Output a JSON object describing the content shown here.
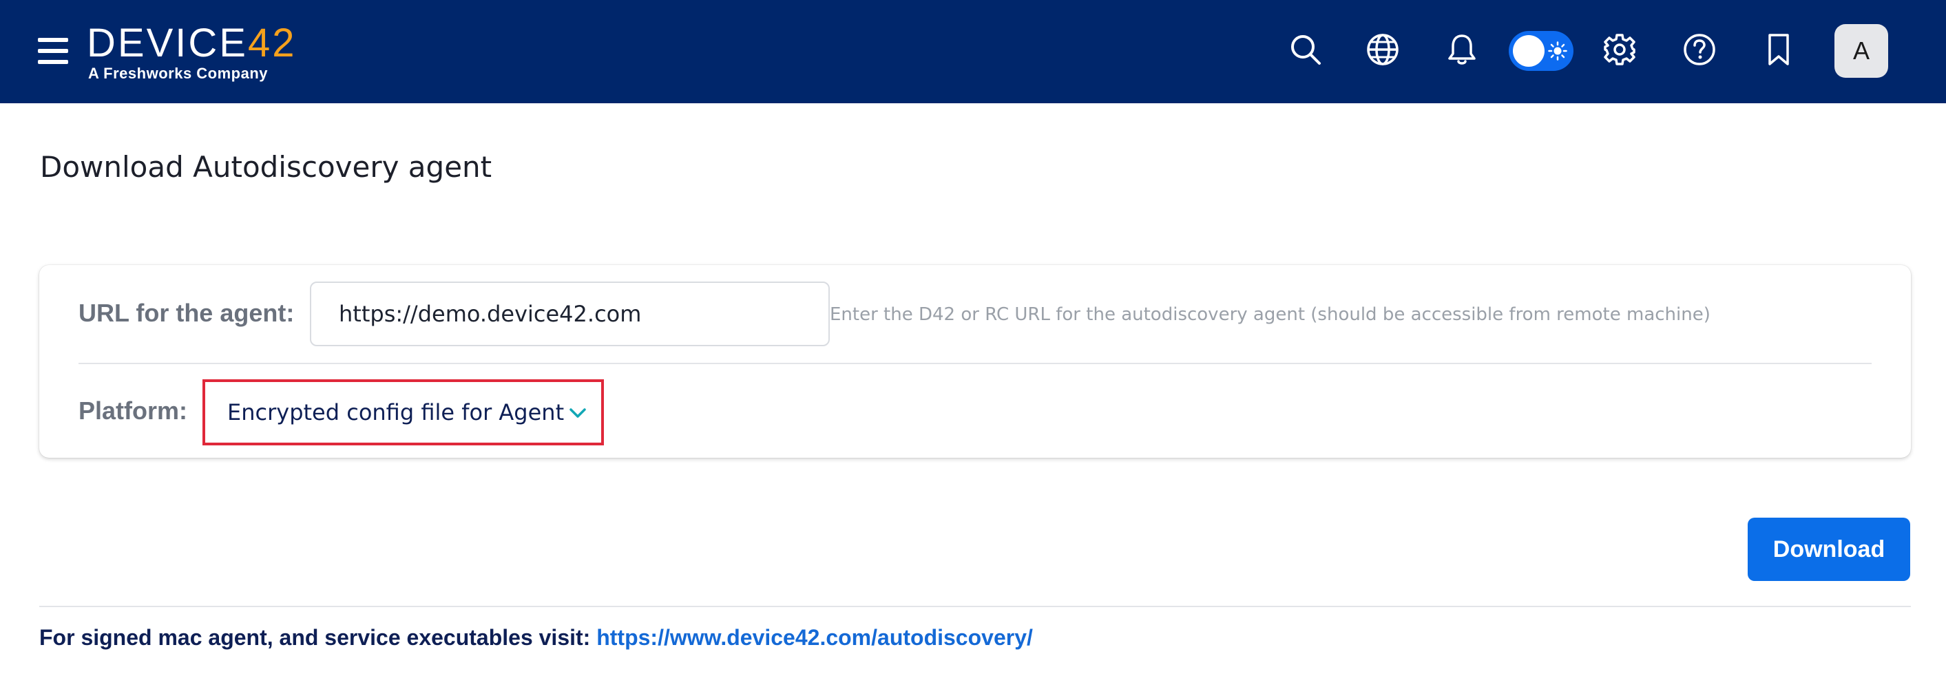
{
  "header": {
    "logo_main": "DEVICE",
    "logo_accent": "42",
    "logo_tagline": "A Freshworks Company",
    "icons": [
      "menu-icon",
      "search-icon",
      "globe-icon",
      "bell-icon",
      "theme-toggle",
      "gear-icon",
      "help-icon",
      "bookmark-icon"
    ],
    "theme_toggle_on": true,
    "avatar_initial": "A"
  },
  "page": {
    "title": "Download Autodiscovery agent"
  },
  "form": {
    "url_label": "URL for the agent:",
    "url_value": "https://demo.device42.com",
    "url_help": "Enter the D42 or RC URL for the autodiscovery agent (should be accessible from remote machine)",
    "platform_label": "Platform:",
    "platform_value": "Encrypted config file for Agent",
    "download_label": "Download"
  },
  "footer": {
    "note": "For signed mac agent, and service executables visit:",
    "link": "https://www.device42.com/autodiscovery/"
  },
  "colors": {
    "header_bg": "#00266b",
    "logo_accent": "#f6a11c",
    "primary": "#0b6ee8",
    "highlight_border": "#e0283a",
    "chevron": "#12a7b5"
  }
}
